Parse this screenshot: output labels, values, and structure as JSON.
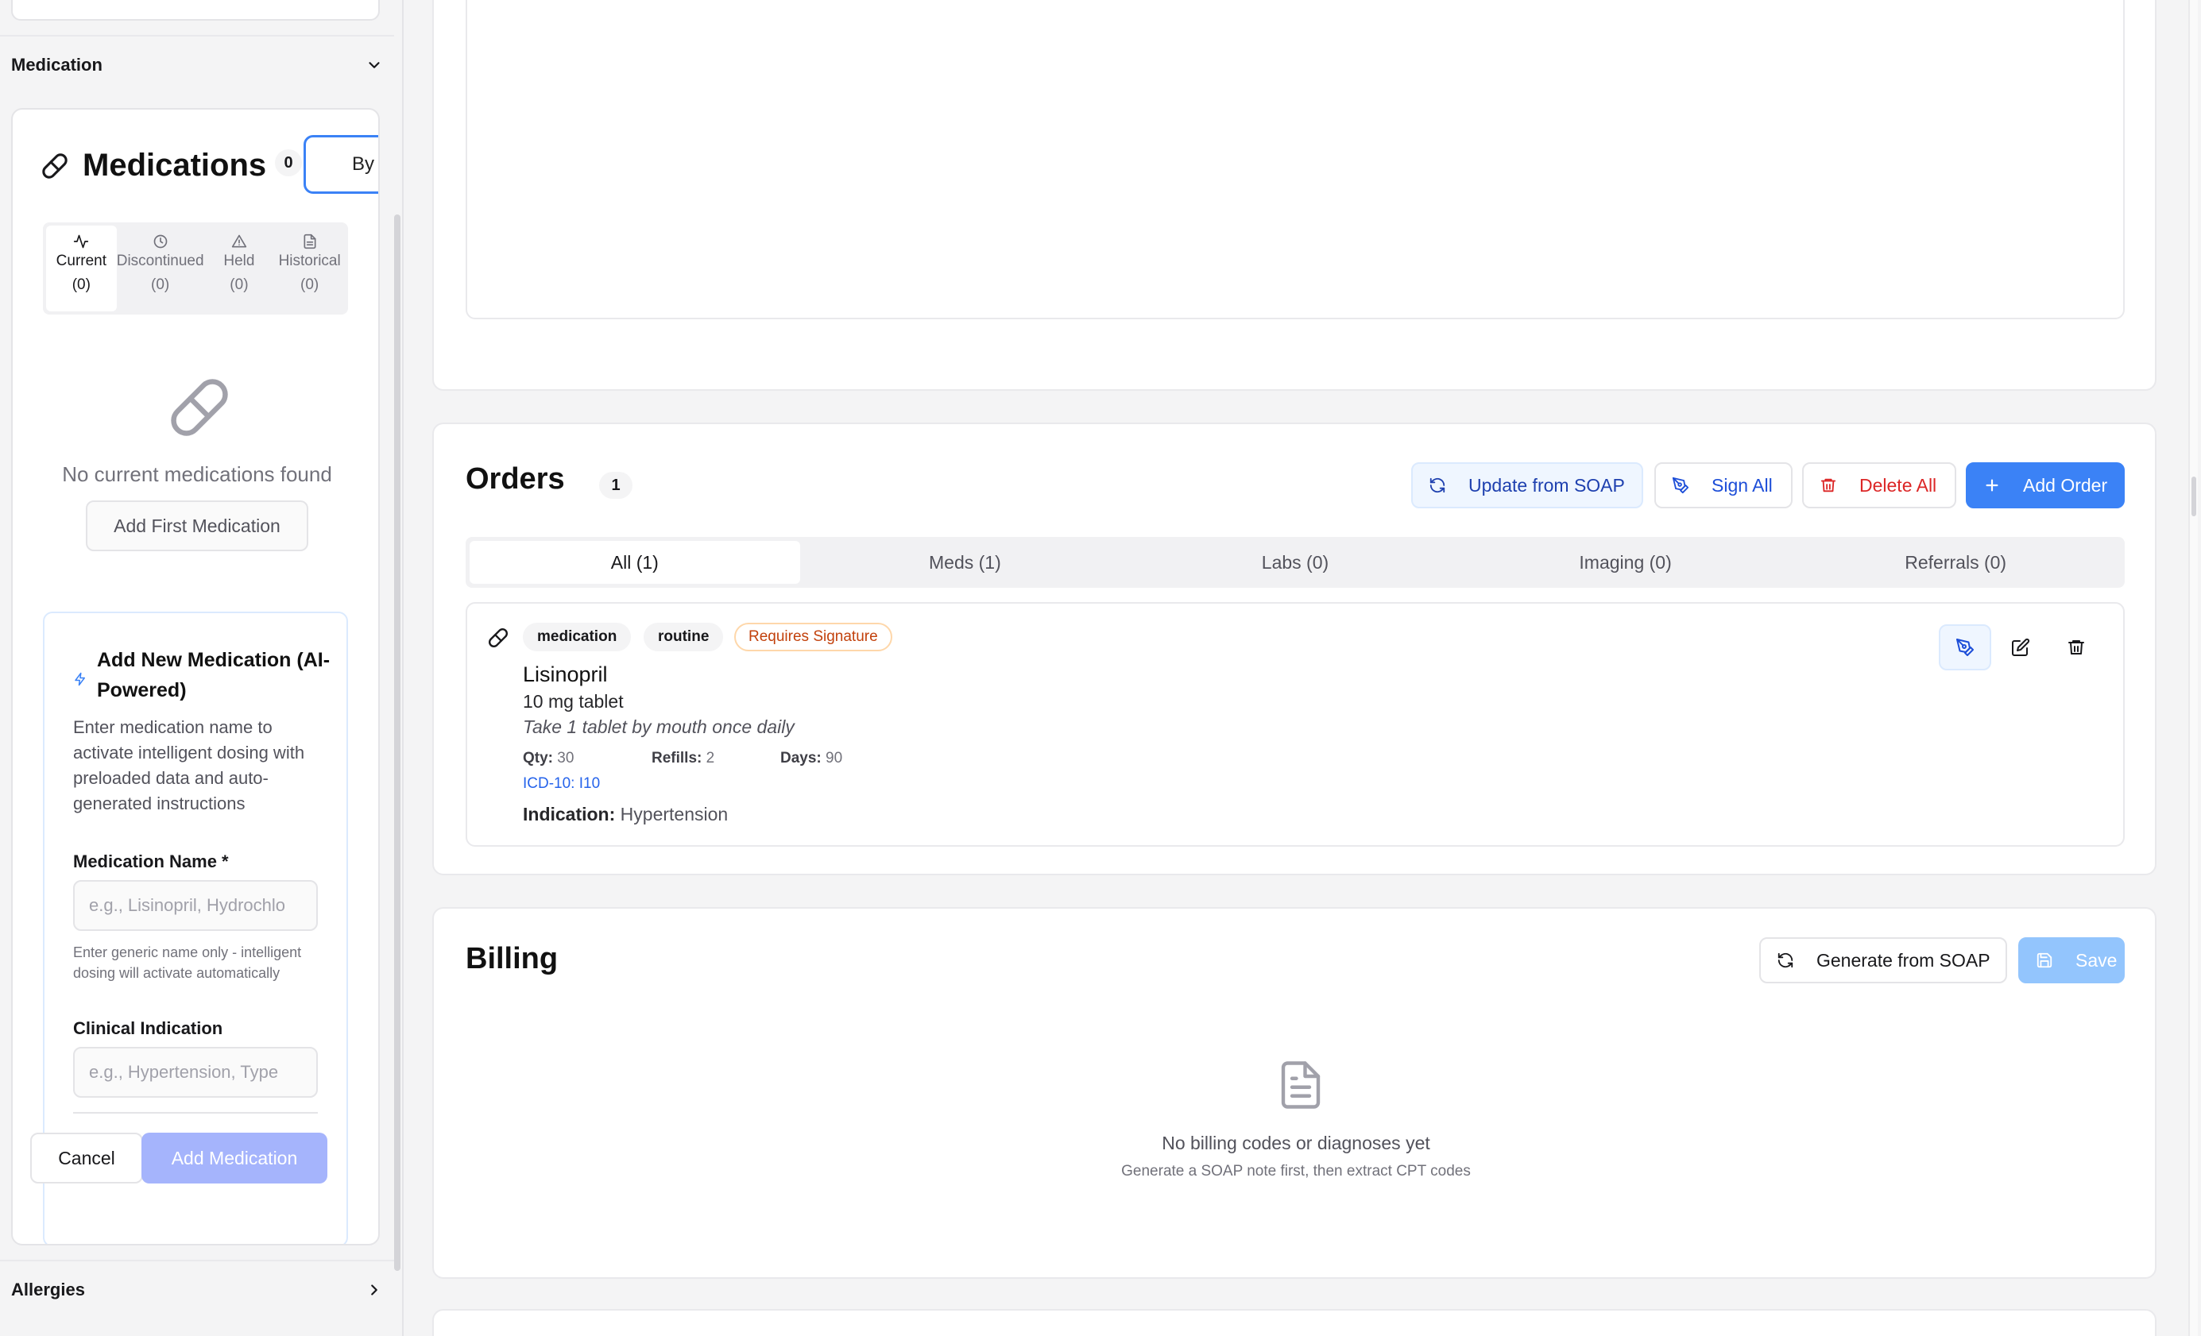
{
  "sidebar": {
    "medication_section_label": "Medication",
    "allergies_section_label": "Allergies",
    "medications": {
      "title": "Medications",
      "count": "0",
      "view_button_label": "By M",
      "status_tabs": [
        {
          "label": "Current",
          "count": "(0)",
          "icon": "activity-icon"
        },
        {
          "label": "Discontinued",
          "count": "(0)",
          "icon": "clock-icon"
        },
        {
          "label": "Held",
          "count": "(0)",
          "icon": "warning-icon"
        },
        {
          "label": "Historical",
          "count": "(0)",
          "icon": "document-icon"
        }
      ],
      "empty_text": "No current medications found",
      "add_first_label": "Add First Medication"
    },
    "add_form": {
      "title": "Add New Medication (AI-Powered)",
      "description": "Enter medication name to activate intelligent dosing with preloaded data and auto-generated instructions",
      "name_label": "Medication Name *",
      "name_placeholder": "e.g., Lisinopril, Hydrochlo",
      "name_hint": "Enter generic name only - intelligent dosing will activate automatically",
      "indication_label": "Clinical Indication",
      "indication_placeholder": "e.g., Hypertension, Type",
      "cancel_label": "Cancel",
      "submit_label": "Add Medication"
    }
  },
  "orders": {
    "title": "Orders",
    "count": "1",
    "update_label": "Update from SOAP",
    "sign_all_label": "Sign All",
    "delete_all_label": "Delete All",
    "add_order_label": "Add Order",
    "tabs": [
      {
        "label": "All (1)"
      },
      {
        "label": "Meds (1)"
      },
      {
        "label": "Labs (0)"
      },
      {
        "label": "Imaging (0)"
      },
      {
        "label": "Referrals (0)"
      }
    ],
    "items": [
      {
        "tags": [
          "medication",
          "routine",
          "Requires Signature"
        ],
        "name": "Lisinopril",
        "strength": "10 mg tablet",
        "sig": "Take 1 tablet by mouth once daily",
        "qty_label": "Qty:",
        "qty": "30",
        "refills_label": "Refills:",
        "refills": "2",
        "days_label": "Days:",
        "days": "90",
        "icd": "ICD-10: I10",
        "indication_label": "Indication:",
        "indication": "Hypertension"
      }
    ]
  },
  "billing": {
    "title": "Billing",
    "generate_label": "Generate from SOAP",
    "save_label": "Save",
    "empty_title": "No billing codes or diagnoses yet",
    "empty_subtitle": "Generate a SOAP note first, then extract CPT codes"
  },
  "colors": {
    "primary": "#3b82f6",
    "danger": "#dc2626",
    "warning": "#c2410c",
    "link": "#2563eb"
  }
}
